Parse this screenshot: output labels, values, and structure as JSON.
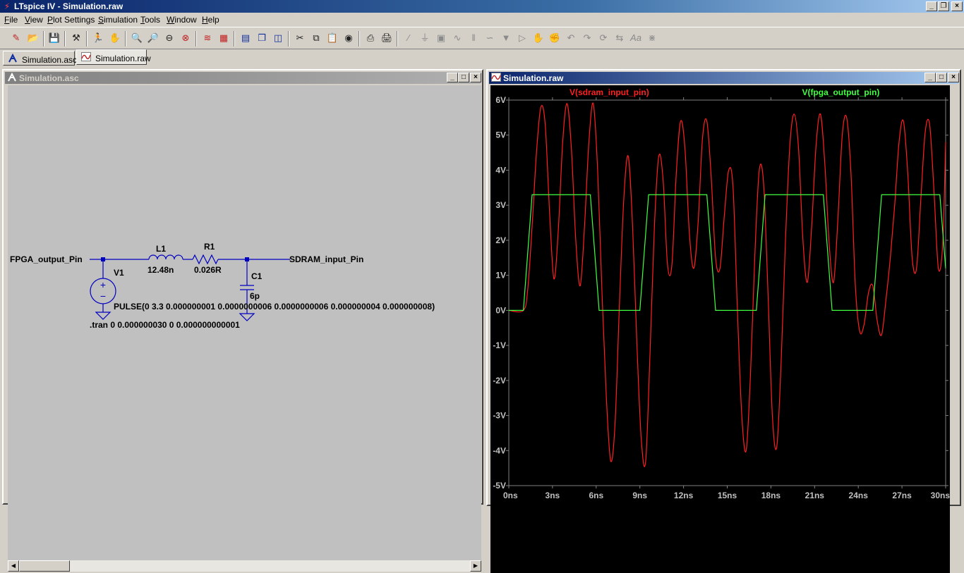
{
  "app": {
    "title": "LTspice IV - Simulation.raw",
    "icon": "ltspice-icon"
  },
  "menu": [
    {
      "label": "File",
      "u": "F",
      "rest": "ile"
    },
    {
      "label": "View",
      "u": "V",
      "rest": "iew"
    },
    {
      "label": "Plot Settings",
      "u": "P",
      "rest": "lot Settings"
    },
    {
      "label": "Simulation",
      "u": "S",
      "rest": "imulation"
    },
    {
      "label": "Tools",
      "u": "T",
      "rest": "ools"
    },
    {
      "label": "Window",
      "u": "W",
      "rest": "indow"
    },
    {
      "label": "Help",
      "u": "H",
      "rest": "elp"
    }
  ],
  "tabs": [
    {
      "label": "Simulation.asc",
      "icon": "schematic-icon",
      "active": false
    },
    {
      "label": "Simulation.raw",
      "icon": "waveform-icon",
      "active": true
    }
  ],
  "schematic": {
    "window_title": "Simulation.asc",
    "labels": {
      "fpga_net": "FPGA_output_Pin",
      "sdram_net": "SDRAM_input_Pin",
      "l1_name": "L1",
      "l1_value": "12.48n",
      "r1_name": "R1",
      "r1_value": "0.026R",
      "c1_name": "C1",
      "c1_value": "6p",
      "v1_name": "V1",
      "v1_value": "PULSE(0 3.3 0.000000001 0.0000000006 0.0000000006 0.000000004 0.000000008)",
      "tran_directive": ".tran 0 0.000000030 0 0.000000000001"
    }
  },
  "plot": {
    "window_title": "Simulation.raw",
    "colors": {
      "background": "#000000",
      "grid": "#808080",
      "axis_text": "#c0c0c0"
    },
    "chart_data": {
      "type": "line",
      "title": "",
      "xlabel": "",
      "ylabel": "",
      "xlim": [
        0,
        30
      ],
      "ylim": [
        -5,
        6
      ],
      "x_unit": "ns",
      "y_unit": "V",
      "x_ticks": [
        "0ns",
        "3ns",
        "6ns",
        "9ns",
        "12ns",
        "15ns",
        "18ns",
        "21ns",
        "24ns",
        "27ns",
        "30ns"
      ],
      "y_ticks": [
        "6V",
        "5V",
        "4V",
        "3V",
        "2V",
        "1V",
        "0V",
        "-1V",
        "-2V",
        "-3V",
        "-4V",
        "-5V"
      ],
      "grid": false,
      "legend": "top",
      "series": [
        {
          "name": "V(sdram_input_pin)",
          "color": "#ff2020",
          "x": [
            0,
            1,
            1.3,
            1.6,
            1.9,
            2.2,
            2.5,
            2.8,
            3.1,
            3.4,
            3.7,
            4.0,
            4.3,
            4.6,
            4.9,
            5.2,
            5.5,
            5.8,
            6.1,
            6.4,
            6.7,
            7.0,
            7.3,
            7.6,
            7.9,
            8.2,
            8.5,
            8.8,
            9.1,
            9.4,
            9.7,
            10.0,
            10.3,
            10.6,
            10.9,
            11.2,
            11.5,
            11.8,
            12.1,
            12.4,
            12.7,
            13.0,
            13.3,
            13.6,
            13.9,
            14.2,
            14.5,
            14.8,
            15.1,
            15.4,
            15.7,
            16.0,
            16.3,
            16.6,
            16.9,
            17.2,
            17.5,
            17.8,
            18.1,
            18.4,
            18.7,
            19.0,
            19.3,
            19.6,
            19.9,
            20.2,
            20.5,
            20.8,
            21.1,
            21.4,
            21.7,
            22.0,
            22.3,
            22.6,
            22.9,
            23.2,
            23.5,
            23.8,
            24.1,
            24.4,
            24.7,
            25.0,
            25.3,
            25.6,
            25.9,
            26.2,
            26.5,
            26.8,
            27.1,
            27.4,
            27.7,
            28.0,
            28.3,
            28.6,
            28.9,
            29.2,
            29.5,
            29.8,
            30
          ],
          "y": [
            0,
            0,
            0.6,
            2.4,
            4.5,
            5.8,
            5.3,
            2.8,
            0.9,
            2.3,
            4.8,
            5.9,
            4.6,
            2.0,
            0.7,
            2.4,
            4.8,
            5.9,
            4.0,
            0.5,
            -2.5,
            -4.3,
            -3.2,
            0.2,
            3.2,
            4.4,
            2.4,
            -1.0,
            -3.7,
            -4.3,
            -1.2,
            2.4,
            4.4,
            3.7,
            1.3,
            1.3,
            3.9,
            5.4,
            4.6,
            2.2,
            1.2,
            2.5,
            4.9,
            5.4,
            3.8,
            1.5,
            1.2,
            2.7,
            4.0,
            3.5,
            0.0,
            -3.0,
            -4.0,
            -1.8,
            1.6,
            4.0,
            3.6,
            0.5,
            -3.0,
            -3.9,
            -1.5,
            2.0,
            4.7,
            5.6,
            4.6,
            2.0,
            0.8,
            2.4,
            4.7,
            5.6,
            4.2,
            1.9,
            0.8,
            2.6,
            5.0,
            5.5,
            3.9,
            0.7,
            -0.6,
            -0.4,
            0.5,
            0.7,
            -0.3,
            -0.7,
            0.3,
            1.5,
            3.0,
            4.8,
            5.4,
            3.9,
            1.5,
            1.2,
            3.2,
            5.1,
            5.3,
            3.4,
            1.2,
            1.9,
            4.8,
            5.4,
            3.6
          ]
        },
        {
          "name": "V(fpga_output_pin)",
          "color": "#40ff40",
          "x": [
            0,
            1,
            1.6,
            5.6,
            6.2,
            9.0,
            9.6,
            13.6,
            14.2,
            17.0,
            17.6,
            21.6,
            22.2,
            25.0,
            25.6,
            29.6,
            30
          ],
          "y": [
            0,
            0,
            3.3,
            3.3,
            0,
            0,
            3.3,
            3.3,
            0,
            0,
            3.3,
            3.3,
            0,
            0,
            3.3,
            3.3,
            1.2
          ]
        }
      ]
    }
  }
}
